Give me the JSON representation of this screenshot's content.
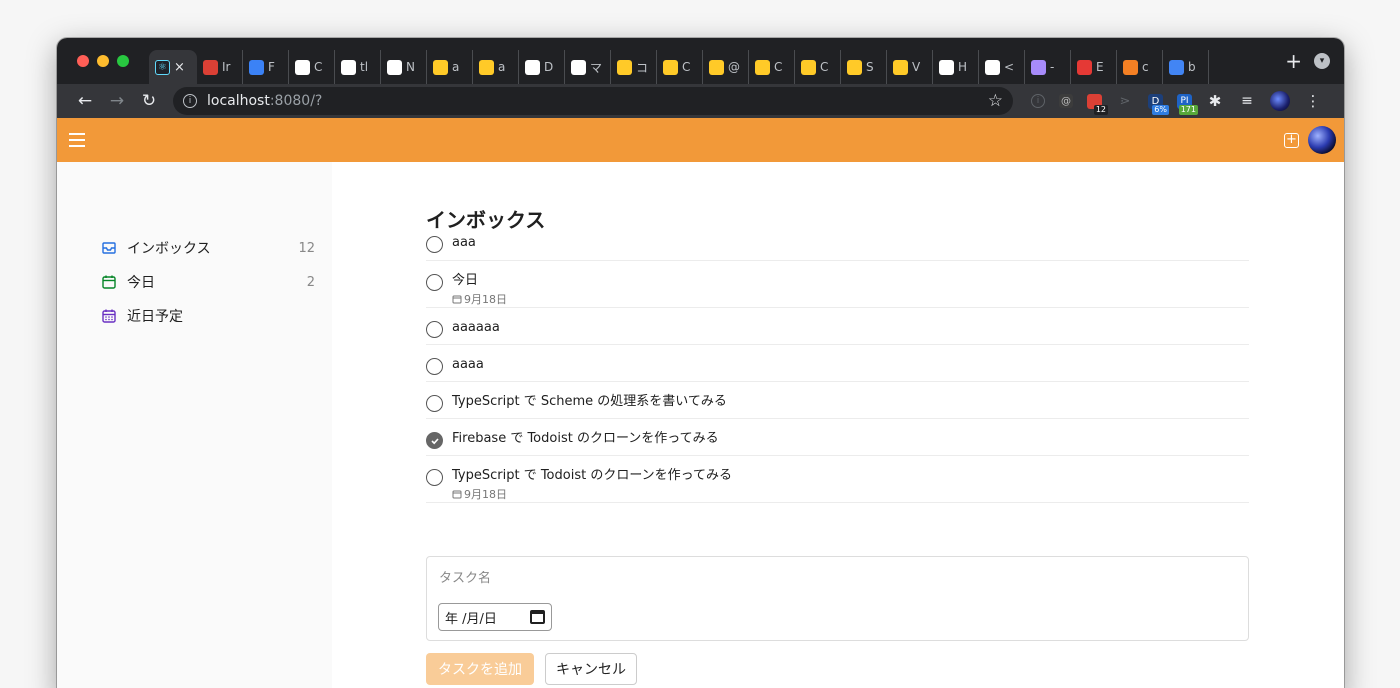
{
  "browser": {
    "active_tab_close": "×",
    "tabs": [
      {
        "letter": "Ir",
        "favicon": "todoist-icon",
        "color": "#db4035"
      },
      {
        "letter": "F",
        "favicon": "flutter-icon",
        "color": "#3b82f6"
      },
      {
        "letter": "C",
        "favicon": "github-icon",
        "color": "#ffffff"
      },
      {
        "letter": "tl",
        "favicon": "github-icon",
        "color": "#ffffff"
      },
      {
        "letter": "N",
        "favicon": "github-icon",
        "color": "#ffffff"
      },
      {
        "letter": "a",
        "favicon": "firebase-icon",
        "color": "#ffca28"
      },
      {
        "letter": "a",
        "favicon": "firebase-icon",
        "color": "#ffca28"
      },
      {
        "letter": "D",
        "favicon": "zenn-icon",
        "color": "#ffffff"
      },
      {
        "letter": "マ",
        "favicon": "f-icon",
        "color": "#ffffff"
      },
      {
        "letter": "コ",
        "favicon": "firebase-icon",
        "color": "#ffca28"
      },
      {
        "letter": "C",
        "favicon": "firebase-icon",
        "color": "#ffca28"
      },
      {
        "letter": "@",
        "favicon": "firebase-icon",
        "color": "#ffca28"
      },
      {
        "letter": "C",
        "favicon": "firebase-icon",
        "color": "#ffca28"
      },
      {
        "letter": "C",
        "favicon": "firebase-icon",
        "color": "#ffca28"
      },
      {
        "letter": "S",
        "favicon": "firebase-icon",
        "color": "#ffca28"
      },
      {
        "letter": "V",
        "favicon": "firebase-icon",
        "color": "#ffca28"
      },
      {
        "letter": "H",
        "favicon": "zenn-icon",
        "color": "#ffffff"
      },
      {
        "letter": "<",
        "favicon": "zenn-icon",
        "color": "#ffffff"
      },
      {
        "letter": "-",
        "favicon": "rocket-icon",
        "color": "#a78bfa"
      },
      {
        "letter": "E",
        "favicon": "red-b-icon",
        "color": "#e53935"
      },
      {
        "letter": "c",
        "favicon": "stackoverflow-icon",
        "color": "#f48024"
      },
      {
        "letter": "b",
        "favicon": "google-icon",
        "color": "#4285f4"
      }
    ],
    "url_host": "localhost",
    "url_rest": ":8080/?",
    "extensions": {
      "todoist_badge": "12",
      "ext_badge_1": "6%",
      "ext_badge_2": "171"
    }
  },
  "sidebar": {
    "items": [
      {
        "label": "インボックス",
        "count": "12",
        "icon": "inbox-icon",
        "color": "#246fe0"
      },
      {
        "label": "今日",
        "count": "2",
        "icon": "calendar-today-icon",
        "color": "#058527"
      },
      {
        "label": "近日予定",
        "count": "",
        "icon": "calendar-upcoming-icon",
        "color": "#692fc2"
      }
    ]
  },
  "main": {
    "title": "インボックス",
    "tasks": [
      {
        "name": "aaa",
        "date": "",
        "done": false
      },
      {
        "name": "今日",
        "date": "9月18日",
        "done": false
      },
      {
        "name": "aaaaaa",
        "date": "",
        "done": false
      },
      {
        "name": "aaaa",
        "date": "",
        "done": false
      },
      {
        "name": "TypeScript で Scheme の処理系を書いてみる",
        "date": "",
        "done": false
      },
      {
        "name": "Firebase で Todoist のクローンを作ってみる",
        "date": "",
        "done": true
      },
      {
        "name": "TypeScript で Todoist のクローンを作ってみる",
        "date": "9月18日",
        "done": false
      }
    ],
    "editor": {
      "placeholder": "タスク名",
      "date_placeholder": "年 /月/日"
    },
    "add_button": "タスクを追加",
    "cancel_button": "キャンセル"
  },
  "colors": {
    "accent": "#f29939",
    "add_button_disabled": "#f9cc98"
  }
}
